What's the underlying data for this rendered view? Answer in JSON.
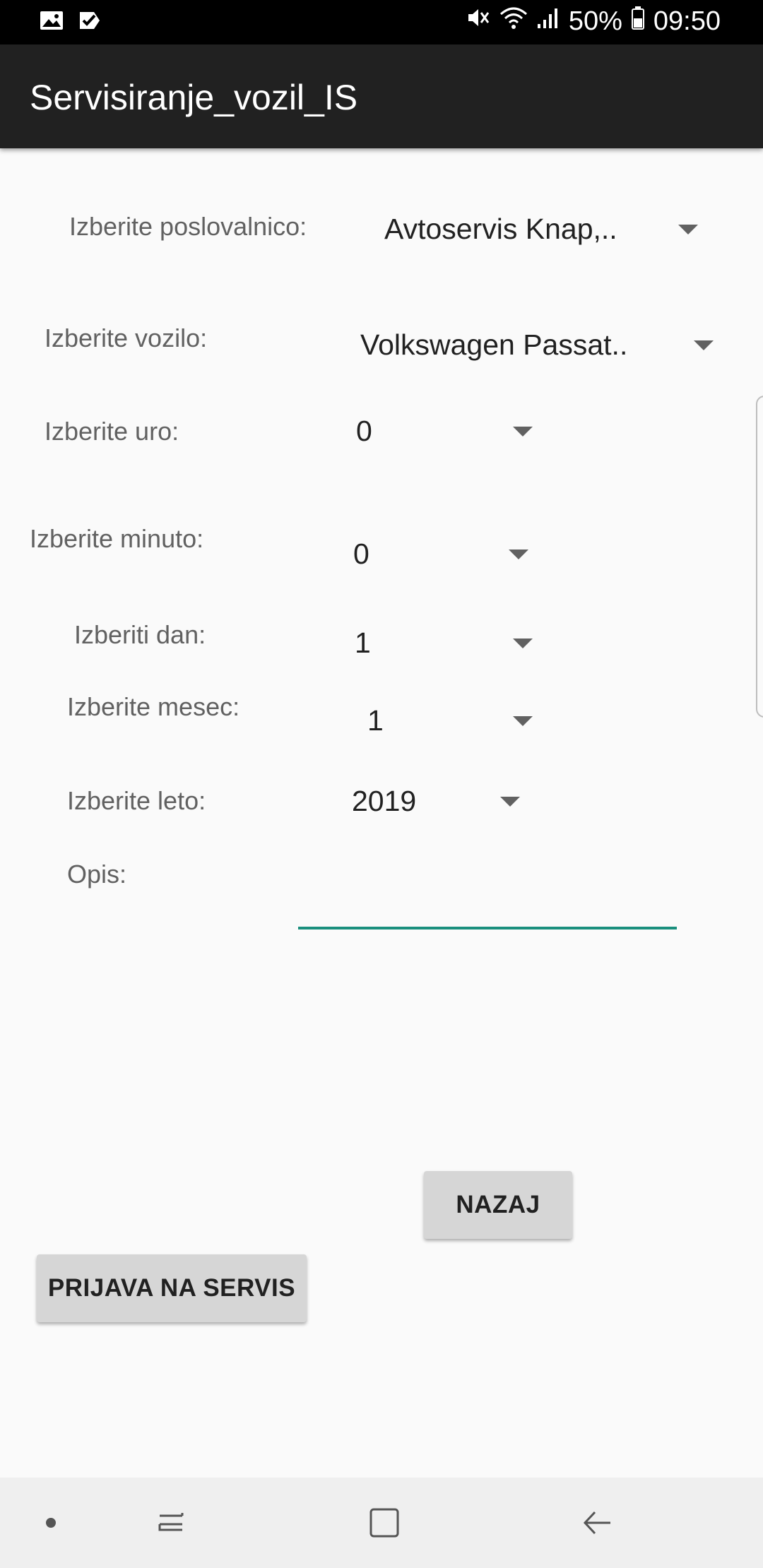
{
  "status_bar": {
    "battery": "50%",
    "time": "09:50",
    "icons": [
      "gallery-icon",
      "check-icon",
      "mute-icon",
      "wifi-icon",
      "signal-icon",
      "battery-icon"
    ]
  },
  "app_bar": {
    "title": "Servisiranje_vozil_IS"
  },
  "form": {
    "poslovalnica": {
      "label": "Izberite poslovalnico:",
      "value": "Avtoservis Knap,.."
    },
    "vozilo": {
      "label": "Izberite vozilo:",
      "value": "Volkswagen Passat.."
    },
    "ura": {
      "label": "Izberite uro:",
      "value": "0"
    },
    "minuta": {
      "label": "Izberite minuto:",
      "value": "0"
    },
    "dan": {
      "label": "Izberiti dan:",
      "value": "1"
    },
    "mesec": {
      "label": "Izberite mesec:",
      "value": "1"
    },
    "leto": {
      "label": "Izberite leto:",
      "value": "2019"
    },
    "opis": {
      "label": "Opis:",
      "value": ""
    }
  },
  "buttons": {
    "nazaj": "NAZAJ",
    "prijava": "PRIJAVA NA SERVIS"
  },
  "colors": {
    "accent": "#1a8f7d",
    "app_bar": "#212121",
    "button": "#d6d6d6"
  },
  "nav_bar": {
    "icons": [
      "dot-icon",
      "recent-apps-icon",
      "home-icon",
      "back-icon"
    ]
  }
}
